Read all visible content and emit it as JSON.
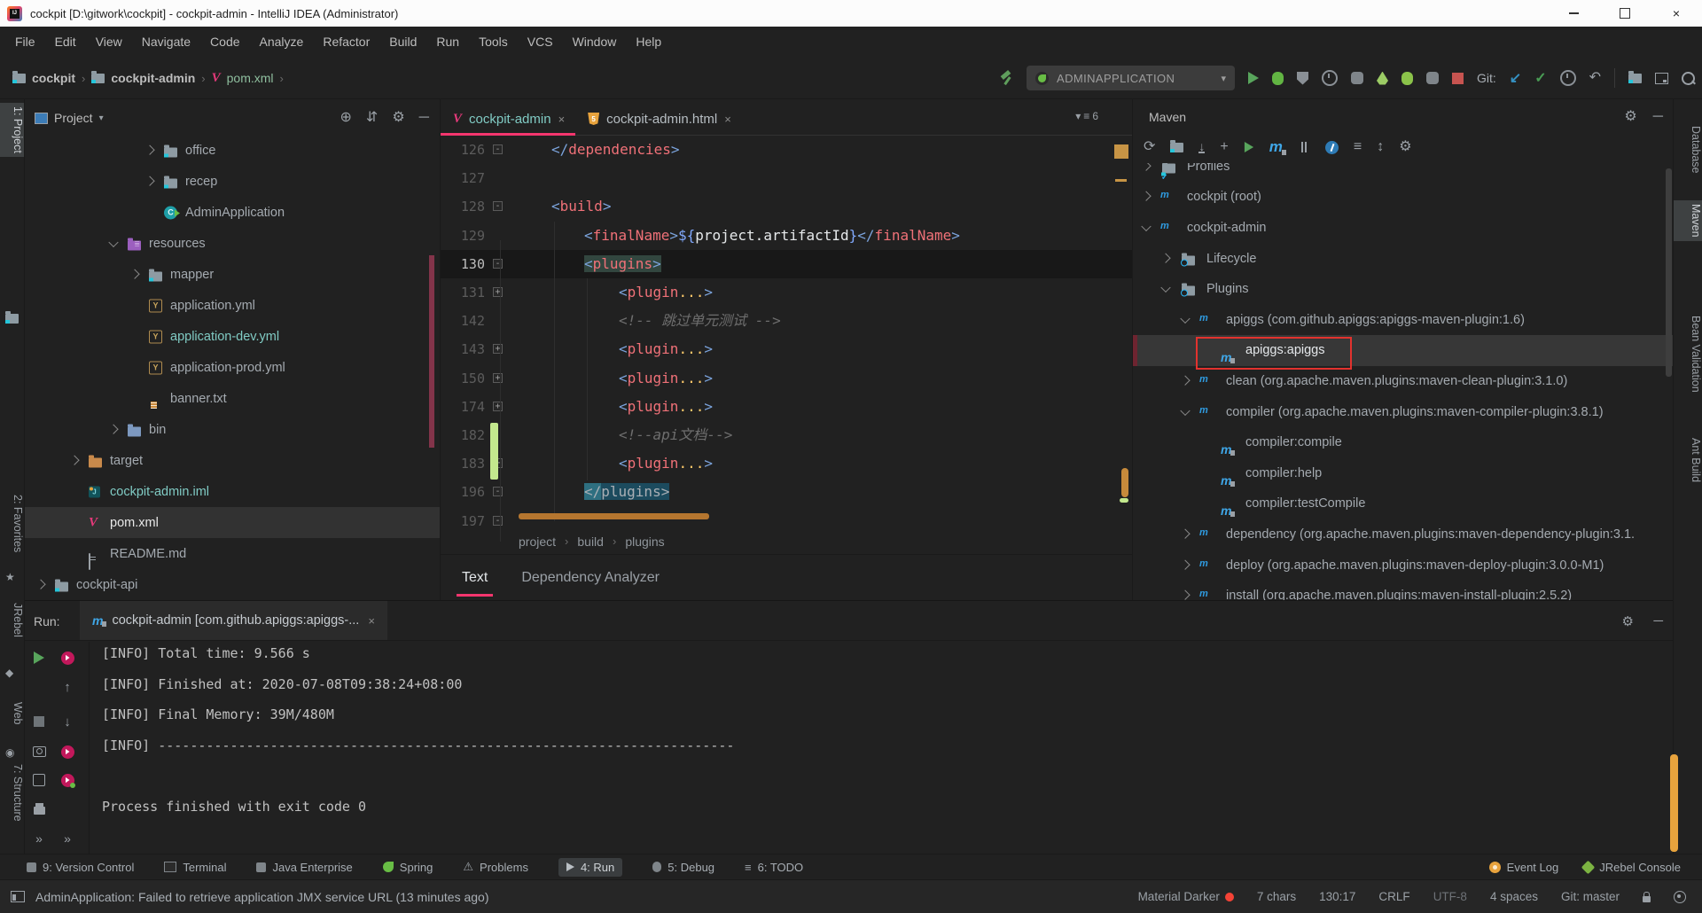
{
  "window": {
    "title": "cockpit [D:\\gitwork\\cockpit] - cockpit-admin - IntelliJ IDEA (Administrator)",
    "controls": [
      "minimize",
      "maximize",
      "close"
    ]
  },
  "menu": {
    "items": [
      "File",
      "Edit",
      "View",
      "Navigate",
      "Code",
      "Analyze",
      "Refactor",
      "Build",
      "Run",
      "Tools",
      "VCS",
      "Window",
      "Help"
    ]
  },
  "toolbar": {
    "breadcrumbs": [
      {
        "label": "cockpit",
        "icon": "folder"
      },
      {
        "label": "cockpit-admin",
        "icon": "folder"
      },
      {
        "label": "pom.xml",
        "icon": "maven"
      }
    ],
    "run_config": "ADMINAPPLICATION",
    "git_label": "Git:"
  },
  "left_stripe": {
    "items": [
      "1: Project",
      "2: Favorites",
      "JRebel",
      "Web",
      "7: Structure"
    ],
    "active": "1: Project"
  },
  "right_stripe": {
    "items": [
      "Database",
      "Maven",
      "Bean Validation",
      "Ant Build"
    ],
    "active": "Maven"
  },
  "project": {
    "title": "Project",
    "tree": [
      {
        "label": "office",
        "icon": "folder",
        "chevron": "collapsed",
        "depth": 4
      },
      {
        "label": "recep",
        "icon": "folder",
        "chevron": "collapsed",
        "depth": 4
      },
      {
        "label": "AdminApplication",
        "icon": "class",
        "depth": 4
      },
      {
        "label": "resources",
        "icon": "folder-resources",
        "chevron": "expanded",
        "depth": 2
      },
      {
        "label": "mapper",
        "icon": "folder",
        "chevron": "collapsed",
        "depth": 3
      },
      {
        "label": "application.yml",
        "icon": "yaml",
        "depth": 3
      },
      {
        "label": "application-dev.yml",
        "icon": "yaml",
        "depth": 3,
        "modified": true
      },
      {
        "label": "application-prod.yml",
        "icon": "yaml",
        "depth": 3
      },
      {
        "label": "banner.txt",
        "icon": "text",
        "depth": 3
      },
      {
        "label": "bin",
        "icon": "folder-blue",
        "chevron": "collapsed",
        "depth": 2
      },
      {
        "label": "target",
        "icon": "folder-excluded",
        "chevron": "collapsed",
        "depth": 1
      },
      {
        "label": "cockpit-admin.iml",
        "icon": "iml",
        "depth": 1,
        "modified": true
      },
      {
        "label": "pom.xml",
        "icon": "maven",
        "depth": 1,
        "selected": true
      },
      {
        "label": "README.md",
        "icon": "md",
        "depth": 1
      },
      {
        "label": "cockpit-api",
        "icon": "folder",
        "chevron": "collapsed",
        "depth": 0
      }
    ]
  },
  "editor": {
    "tabs": [
      {
        "label": "cockpit-admin",
        "icon": "maven",
        "active": true
      },
      {
        "label": "cockpit-admin.html",
        "icon": "html",
        "active": false
      }
    ],
    "tab_list_count": "6",
    "lines": [
      {
        "n": "126",
        "fold": "minus",
        "ind": 1,
        "seg": [
          [
            "</",
            "b"
          ],
          [
            "dependencies",
            "t"
          ],
          [
            ">",
            "b"
          ]
        ]
      },
      {
        "n": "127",
        "ind": 0,
        "seg": []
      },
      {
        "n": "128",
        "fold": "minus",
        "ind": 1,
        "seg": [
          [
            "<",
            "b"
          ],
          [
            "build",
            "t"
          ],
          [
            ">",
            "b"
          ]
        ]
      },
      {
        "n": "129",
        "ind": 2,
        "seg": [
          [
            "<",
            "b"
          ],
          [
            "finalName",
            "t"
          ],
          [
            ">",
            "b"
          ],
          [
            "${",
            "v"
          ],
          [
            "project.artifactId",
            "w"
          ],
          [
            "}",
            "v"
          ],
          [
            "</",
            "b"
          ],
          [
            "finalName",
            "t"
          ],
          [
            ">",
            "b"
          ]
        ]
      },
      {
        "n": "130",
        "fold": "minus",
        "ind": 2,
        "caret": true,
        "seg": [
          [
            "<",
            "b h1"
          ],
          [
            "plugins",
            "t h1"
          ],
          [
            ">",
            "b h1"
          ]
        ]
      },
      {
        "n": "131",
        "fold": "plus",
        "ind": 3,
        "seg": [
          [
            "<",
            "b"
          ],
          [
            "plugin",
            "t"
          ],
          [
            "...",
            "f"
          ],
          [
            ">",
            "b"
          ]
        ]
      },
      {
        "n": "142",
        "ind": 3,
        "seg": [
          [
            "<!-- 跳过单元测试 -->",
            "c"
          ]
        ]
      },
      {
        "n": "143",
        "fold": "plus",
        "ind": 3,
        "seg": [
          [
            "<",
            "b"
          ],
          [
            "plugin",
            "t"
          ],
          [
            "...",
            "f"
          ],
          [
            ">",
            "b"
          ]
        ]
      },
      {
        "n": "150",
        "fold": "plus",
        "ind": 3,
        "seg": [
          [
            "<",
            "b"
          ],
          [
            "plugin",
            "t"
          ],
          [
            "...",
            "f"
          ],
          [
            ">",
            "b"
          ]
        ]
      },
      {
        "n": "174",
        "fold": "plus",
        "ind": 3,
        "seg": [
          [
            "<",
            "b"
          ],
          [
            "plugin",
            "t"
          ],
          [
            "...",
            "f"
          ],
          [
            ">",
            "b"
          ]
        ]
      },
      {
        "n": "182",
        "ind": 3,
        "green": true,
        "seg": [
          [
            "<!--api文档-->",
            "c"
          ]
        ]
      },
      {
        "n": "183",
        "fold": "plus",
        "ind": 3,
        "green": true,
        "seg": [
          [
            "<",
            "b"
          ],
          [
            "plugin",
            "t"
          ],
          [
            "...",
            "f"
          ],
          [
            ">",
            "b"
          ]
        ]
      },
      {
        "n": "196",
        "fold": "minus",
        "ind": 2,
        "seg": [
          [
            "</",
            "h2a"
          ],
          [
            "plugins>",
            "h2b"
          ]
        ]
      },
      {
        "n": "197",
        "fold": "minus",
        "ind": 0,
        "seg": []
      }
    ],
    "breadcrumb": [
      "project",
      "build",
      "plugins"
    ],
    "panel_tabs": [
      {
        "label": "Text",
        "active": true
      },
      {
        "label": "Dependency Analyzer",
        "active": false
      }
    ]
  },
  "maven": {
    "title": "Maven",
    "toolbar": [
      "reimport",
      "generate-sources",
      "download-sources",
      "add-maven-project",
      "run-maven-build",
      "execute-maven-goal",
      "toggle-offline",
      "toggle-skip-tests",
      "maven-profiles",
      "expand-collapse",
      "maven-settings"
    ],
    "tree": [
      {
        "label": "Profiles",
        "icon": "profiles",
        "chevron": "collapsed",
        "depth": 0
      },
      {
        "label": "cockpit (root)",
        "icon": "module",
        "chevron": "collapsed",
        "depth": 0
      },
      {
        "label": "cockpit-admin",
        "icon": "module",
        "chevron": "expanded",
        "depth": 0
      },
      {
        "label": "Lifecycle",
        "icon": "lifecycle",
        "chevron": "collapsed",
        "depth": 1
      },
      {
        "label": "Plugins",
        "icon": "lifecycle",
        "chevron": "expanded",
        "depth": 1
      },
      {
        "label": "apiggs (com.github.apiggs:apiggs-maven-plugin:1.6)",
        "icon": "plugin",
        "chevron": "expanded",
        "depth": 2
      },
      {
        "label": "apiggs:apiggs",
        "icon": "goal",
        "depth": 3,
        "selected": true,
        "annotated": true
      },
      {
        "label": "clean (org.apache.maven.plugins:maven-clean-plugin:3.1.0)",
        "icon": "plugin",
        "chevron": "collapsed",
        "depth": 2
      },
      {
        "label": "compiler (org.apache.maven.plugins:maven-compiler-plugin:3.8.1)",
        "icon": "plugin",
        "chevron": "expanded",
        "depth": 2
      },
      {
        "label": "compiler:compile",
        "icon": "goal",
        "depth": 3
      },
      {
        "label": "compiler:help",
        "icon": "goal",
        "depth": 3
      },
      {
        "label": "compiler:testCompile",
        "icon": "goal",
        "depth": 3
      },
      {
        "label": "dependency (org.apache.maven.plugins:maven-dependency-plugin:3.1.",
        "icon": "plugin",
        "chevron": "collapsed",
        "depth": 2
      },
      {
        "label": "deploy (org.apache.maven.plugins:maven-deploy-plugin:3.0.0-M1)",
        "icon": "plugin",
        "chevron": "collapsed",
        "depth": 2
      },
      {
        "label": "install (org.apache.maven.plugins:maven-install-plugin:2.5.2)",
        "icon": "plugin",
        "chevron": "collapsed",
        "depth": 2
      }
    ]
  },
  "run_panel": {
    "label": "Run:",
    "tab": {
      "title": "cockpit-admin [com.github.apiggs:apiggs-...",
      "icon": "maven-goal"
    },
    "console": [
      "[INFO] Total time: 9.566 s",
      "[INFO] Finished at: 2020-07-08T09:38:24+08:00",
      "[INFO] Final Memory: 39M/480M",
      "[INFO] ------------------------------------------------------------------------",
      "",
      "Process finished with exit code 0"
    ]
  },
  "bottom_bar": {
    "left": [
      {
        "label": "9: Version Control",
        "icon": "vcs"
      },
      {
        "label": "Terminal",
        "icon": "terminal"
      },
      {
        "label": "Java Enterprise",
        "icon": "jee"
      },
      {
        "label": "Spring",
        "icon": "spring"
      },
      {
        "label": "Problems",
        "icon": "problems"
      },
      {
        "label": "4: Run",
        "icon": "run",
        "active": true
      },
      {
        "label": "5: Debug",
        "icon": "debug"
      },
      {
        "label": "6: TODO",
        "icon": "todo"
      }
    ],
    "right": [
      {
        "label": "Event Log",
        "icon": "event-log"
      },
      {
        "label": "JRebel Console",
        "icon": "jrebel"
      }
    ]
  },
  "status_bar": {
    "message": "AdminApplication: Failed to retrieve application JMX service URL (13 minutes ago)",
    "items": [
      "Material Darker",
      "7 chars",
      "130:17",
      "CRLF",
      "UTF-8",
      "4 spaces",
      "Git: master"
    ]
  },
  "colors": {
    "accent_pink": "#F4366E",
    "modified_teal": "#80CBC4",
    "run_green": "#58A55C",
    "stop_red": "#C75450",
    "warning_orange": "#C79445",
    "added_green": "#C3E88D",
    "changed_rose": "#83344A"
  }
}
